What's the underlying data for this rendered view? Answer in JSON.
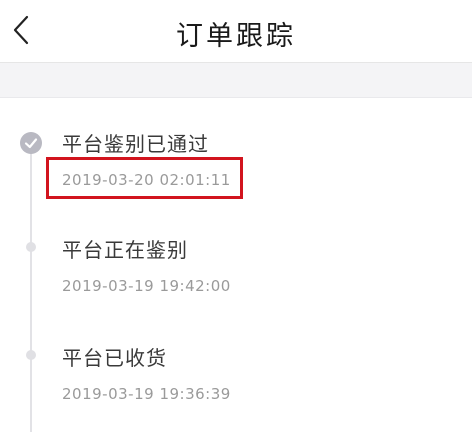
{
  "header": {
    "title": "订单跟踪",
    "back_icon": "chevron-left-icon"
  },
  "timeline": {
    "events": [
      {
        "title": "平台鉴别已通过",
        "time": "2019-03-20 02:01:11",
        "status": "done",
        "icon": "check-icon",
        "highlighted": true
      },
      {
        "title": "平台正在鉴别",
        "time": "2019-03-19 19:42:00",
        "status": "pending"
      },
      {
        "title": "平台已收货",
        "time": "2019-03-19 19:36:39",
        "status": "pending"
      }
    ]
  },
  "colors": {
    "highlight": "#d2141e",
    "done_dot": "#b9b9c2",
    "line": "#e2e2e6"
  }
}
